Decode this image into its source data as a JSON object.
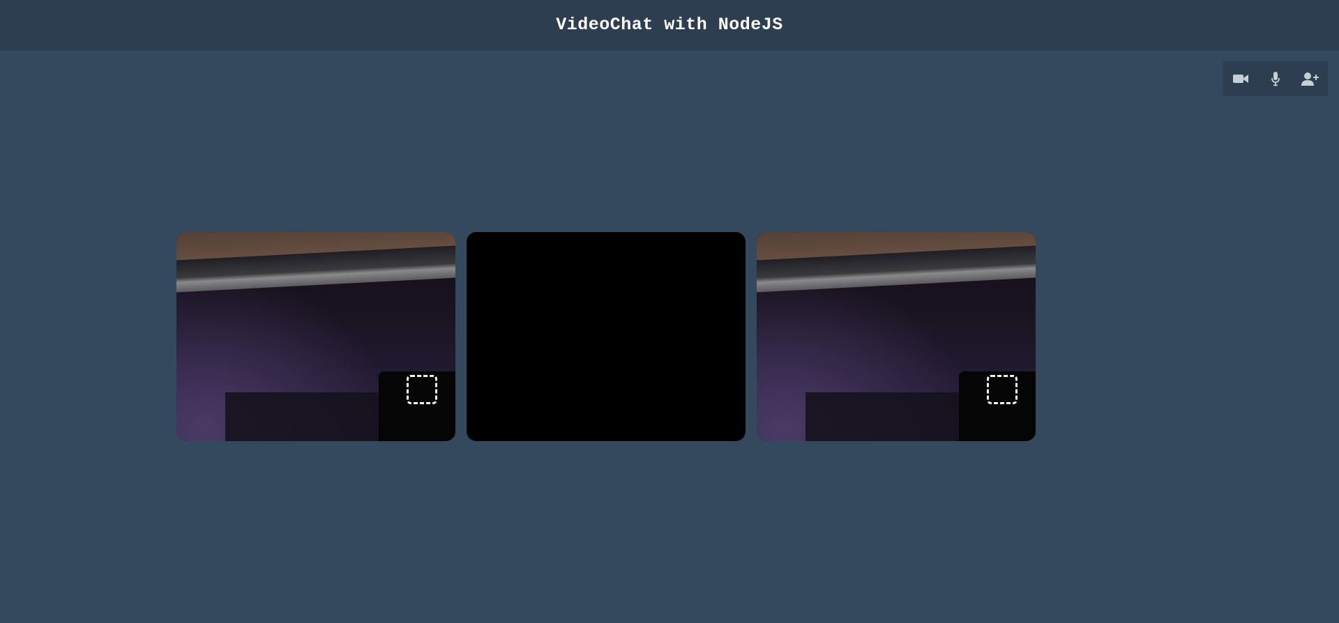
{
  "header": {
    "title": "VideoChat with NodeJS"
  },
  "controls": [
    {
      "icon": "video-camera-icon"
    },
    {
      "icon": "microphone-icon"
    },
    {
      "icon": "add-user-icon"
    }
  ],
  "videos": [
    {
      "state": "camera-feed"
    },
    {
      "state": "no-video"
    },
    {
      "state": "camera-feed"
    }
  ],
  "colors": {
    "background": "#34495e",
    "header": "#2c3e50",
    "control_bar": "#2c3e50",
    "icon": "#c7cfd6"
  }
}
